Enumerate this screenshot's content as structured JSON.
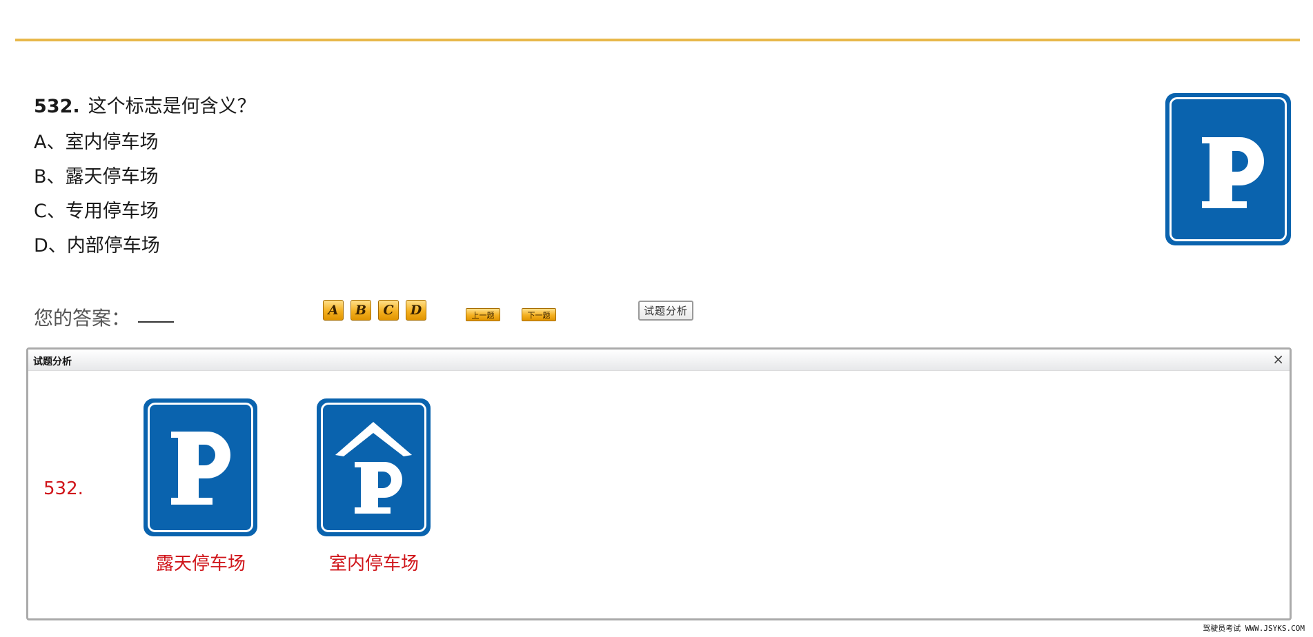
{
  "question": {
    "number": "532.",
    "text": "这个标志是何含义？",
    "options": [
      "A、室内停车场",
      "B、露天停车场",
      "C、专用停车场",
      "D、内部停车场"
    ],
    "sign_icon": "parking-sign-icon"
  },
  "answer": {
    "label": "您的答案："
  },
  "buttons": {
    "choices": [
      "A",
      "B",
      "C",
      "D"
    ],
    "prev": "上一题",
    "next": "下一题",
    "analysis": "试题分析"
  },
  "panel": {
    "title": "试题分析",
    "close": "×",
    "number": "532.",
    "items": [
      {
        "caption": "露天停车场",
        "icon": "outdoor-parking-sign-icon"
      },
      {
        "caption": "室内停车场",
        "icon": "indoor-parking-sign-icon"
      }
    ]
  },
  "footer": {
    "watermark": "驾驶员考试 WWW.JSYKS.COM"
  },
  "colors": {
    "accent_rule": "#E8B84A",
    "sign_blue": "#0A63AE",
    "caption_red": "#D0161B",
    "button_gold": "#F4B020"
  }
}
